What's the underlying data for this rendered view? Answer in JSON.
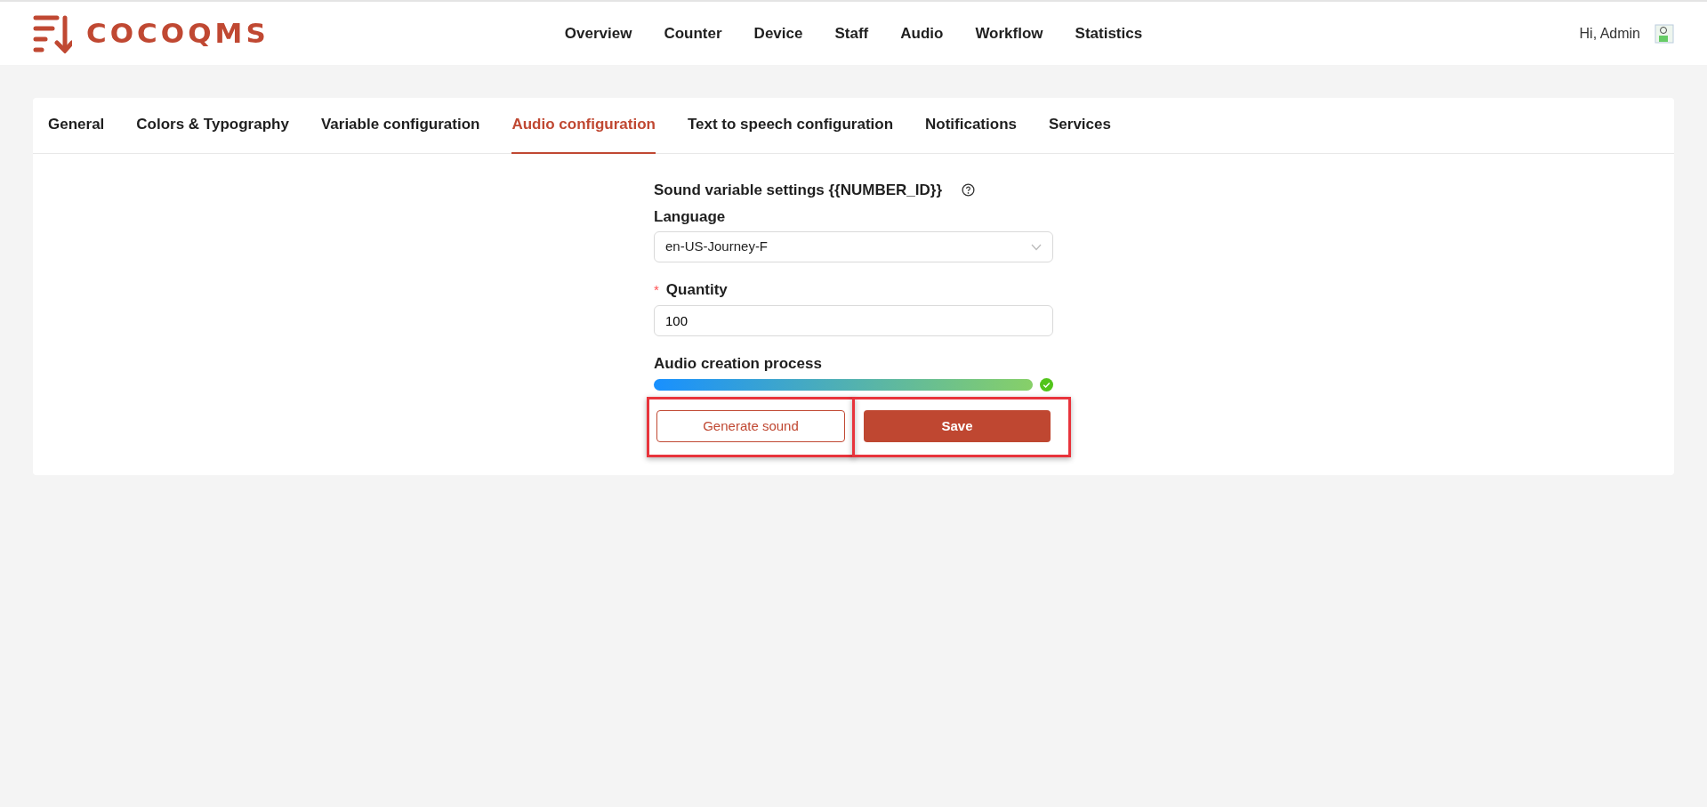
{
  "header": {
    "logo_text": "COCOQMS",
    "nav": [
      {
        "label": "Overview",
        "selected": false
      },
      {
        "label": "Counter",
        "selected": false
      },
      {
        "label": "Device",
        "selected": false
      },
      {
        "label": "Staff",
        "selected": false
      },
      {
        "label": "Audio",
        "selected": false
      },
      {
        "label": "Workflow",
        "selected": false
      },
      {
        "label": "Statistics",
        "selected": false
      }
    ],
    "greeting": "Hi, Admin"
  },
  "tabs": [
    {
      "label": "General",
      "selected": false
    },
    {
      "label": "Colors & Typography",
      "selected": false
    },
    {
      "label": "Variable configuration",
      "selected": false
    },
    {
      "label": "Audio configuration",
      "selected": true
    },
    {
      "label": "Text to speech configuration",
      "selected": false
    },
    {
      "label": "Notifications",
      "selected": false
    },
    {
      "label": "Services",
      "selected": false
    }
  ],
  "form": {
    "title": "Sound variable settings {{NUMBER_ID}}",
    "language": {
      "label": "Language",
      "value": "en-US-Journey-F"
    },
    "quantity": {
      "label": "Quantity",
      "required": true,
      "required_mark": "*",
      "value": "100"
    },
    "progress": {
      "label": "Audio creation process",
      "level": 1,
      "done": true
    },
    "buttons": [
      {
        "label": "Generate sound",
        "kind": "outline",
        "highlighted": true
      },
      {
        "label": "Save",
        "kind": "primary",
        "highlighted": true
      }
    ]
  }
}
